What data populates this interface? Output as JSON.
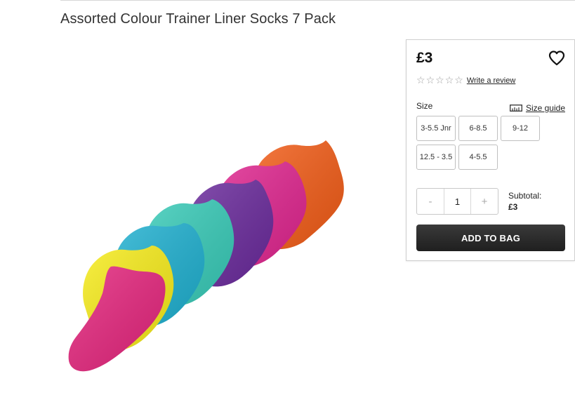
{
  "product": {
    "title": "Assorted Colour Trainer Liner Socks 7 Pack",
    "image_alt": "Seven trainer liner socks in pink, yellow, blue, turquoise, purple, magenta and orange"
  },
  "purchase_panel": {
    "price": "£3",
    "wishlist_icon": "heart-icon",
    "rating": {
      "stars_filled": 0,
      "stars_total": 5,
      "review_link": "Write a review"
    },
    "size_label": "Size",
    "size_guide_label": "Size guide",
    "size_guide_icon": "ruler-icon",
    "sizes": [
      "3-5.5 Jnr",
      "6-8.5",
      "9-12",
      "12.5 - 3.5",
      "4-5.5"
    ],
    "quantity": {
      "decrement": "-",
      "value": "1",
      "increment": "+"
    },
    "subtotal_label": "Subtotal:",
    "subtotal_value": "£3",
    "add_to_bag": "ADD TO BAG"
  },
  "colors": {
    "button_dark": "#262626",
    "star_empty": "#a0a0a0",
    "sock_colors": [
      "#e5257d",
      "#f7ec1a",
      "#1fb0d0",
      "#38cbb8",
      "#6a2a9c",
      "#e0258f",
      "#f25c17"
    ]
  }
}
